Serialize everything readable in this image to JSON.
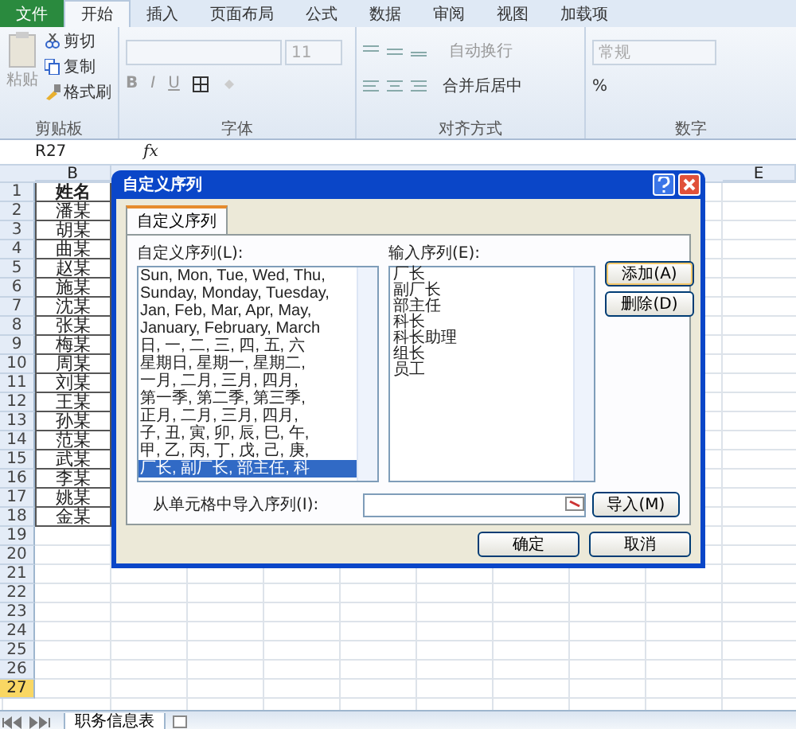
{
  "menu_tabs": [
    {
      "label": "文件",
      "kind": "file",
      "selected": false
    },
    {
      "label": "开始",
      "kind": "tab",
      "selected": true
    },
    {
      "label": "插入",
      "kind": "tab",
      "selected": false
    },
    {
      "label": "页面布局",
      "kind": "tab",
      "selected": false
    },
    {
      "label": "公式",
      "kind": "tab",
      "selected": false
    },
    {
      "label": "数据",
      "kind": "tab",
      "selected": false
    },
    {
      "label": "审阅",
      "kind": "tab",
      "selected": false
    },
    {
      "label": "视图",
      "kind": "tab",
      "selected": false
    },
    {
      "label": "加载项",
      "kind": "tab",
      "selected": false
    }
  ],
  "ribbon": {
    "clipboard": {
      "title": "剪贴板",
      "paste": "粘贴",
      "cut": "剪切",
      "copy": "复制",
      "format_painter": "格式刷"
    },
    "font": {
      "title": "字体",
      "size": "11",
      "bold": "B",
      "italic": "I",
      "underline": "U"
    },
    "alignment": {
      "title": "对齐方式",
      "wrap": "自动换行",
      "merge": "合并后居中"
    },
    "number": {
      "title": "数字",
      "format": "常规",
      "percent": "%"
    }
  },
  "formula_bar": {
    "name_box": "R27",
    "fx": "fx"
  },
  "columns": [
    "B",
    "E"
  ],
  "rows": [
    {
      "number": "1",
      "value": "姓名",
      "kind": "header",
      "selected": false
    },
    {
      "number": "2",
      "value": "潘某",
      "kind": "cell",
      "selected": false
    },
    {
      "number": "3",
      "value": "胡某",
      "kind": "cell",
      "selected": false
    },
    {
      "number": "4",
      "value": "曲某",
      "kind": "cell",
      "selected": false
    },
    {
      "number": "5",
      "value": "赵某",
      "kind": "cell",
      "selected": false
    },
    {
      "number": "6",
      "value": "施某",
      "kind": "cell",
      "selected": false
    },
    {
      "number": "7",
      "value": "沈某",
      "kind": "cell",
      "selected": false
    },
    {
      "number": "8",
      "value": "张某",
      "kind": "cell",
      "selected": false
    },
    {
      "number": "9",
      "value": "梅某",
      "kind": "cell",
      "selected": false
    },
    {
      "number": "10",
      "value": "周某",
      "kind": "cell",
      "selected": false
    },
    {
      "number": "11",
      "value": "刘某",
      "kind": "cell",
      "selected": false
    },
    {
      "number": "12",
      "value": "王某",
      "kind": "cell",
      "selected": false
    },
    {
      "number": "13",
      "value": "孙某",
      "kind": "cell",
      "selected": false
    },
    {
      "number": "14",
      "value": "范某",
      "kind": "cell",
      "selected": false
    },
    {
      "number": "15",
      "value": "武某",
      "kind": "cell",
      "selected": false
    },
    {
      "number": "16",
      "value": "李某",
      "kind": "cell",
      "selected": false
    },
    {
      "number": "17",
      "value": "姚某",
      "kind": "cell",
      "selected": false
    },
    {
      "number": "18",
      "value": "金某",
      "kind": "cell",
      "selected": false
    },
    {
      "number": "19",
      "kind": "empty",
      "selected": false
    },
    {
      "number": "20",
      "kind": "empty",
      "selected": false
    },
    {
      "number": "21",
      "kind": "empty",
      "selected": false
    },
    {
      "number": "22",
      "kind": "empty",
      "selected": false
    },
    {
      "number": "23",
      "kind": "empty",
      "selected": false
    },
    {
      "number": "24",
      "kind": "empty",
      "selected": false
    },
    {
      "number": "25",
      "kind": "empty",
      "selected": false
    },
    {
      "number": "26",
      "kind": "empty",
      "selected": false
    },
    {
      "number": "27",
      "kind": "empty",
      "selected": true
    }
  ],
  "dialog": {
    "title": "自定义序列",
    "tab": "自定义序列",
    "lists_label": "自定义序列(L):",
    "lists": [
      {
        "text": "Sun, Mon, Tue, Wed, Thu,",
        "selected": false
      },
      {
        "text": "Sunday, Monday, Tuesday,",
        "selected": false
      },
      {
        "text": "Jan, Feb, Mar, Apr, May,",
        "selected": false
      },
      {
        "text": "January, February, March",
        "selected": false
      },
      {
        "text": "日, 一, 二, 三, 四, 五, 六",
        "selected": false
      },
      {
        "text": "星期日, 星期一, 星期二,",
        "selected": false
      },
      {
        "text": "一月, 二月, 三月, 四月,",
        "selected": false
      },
      {
        "text": "第一季, 第二季, 第三季,",
        "selected": false
      },
      {
        "text": "正月, 二月, 三月, 四月,",
        "selected": false
      },
      {
        "text": "子, 丑, 寅, 卯, 辰, 巳, 午,",
        "selected": false
      },
      {
        "text": "甲, 乙, 丙, 丁, 戊, 己, 庚,",
        "selected": false
      },
      {
        "text": "厂长, 副厂长, 部主任, 科",
        "selected": true
      }
    ],
    "entries_label": "输入序列(E):",
    "entries": [
      "厂长",
      "副厂长",
      "部主任",
      "科长",
      "科长助理",
      "组长",
      "员工"
    ],
    "add_button": "添加(A)",
    "delete_button": "删除(D)",
    "import_label": "从单元格中导入序列(I):",
    "import_button": "导入(M)",
    "ok_button": "确定",
    "cancel_button": "取消"
  },
  "sheet_tabs": [
    {
      "label": "职务信息表",
      "selected": true
    }
  ]
}
